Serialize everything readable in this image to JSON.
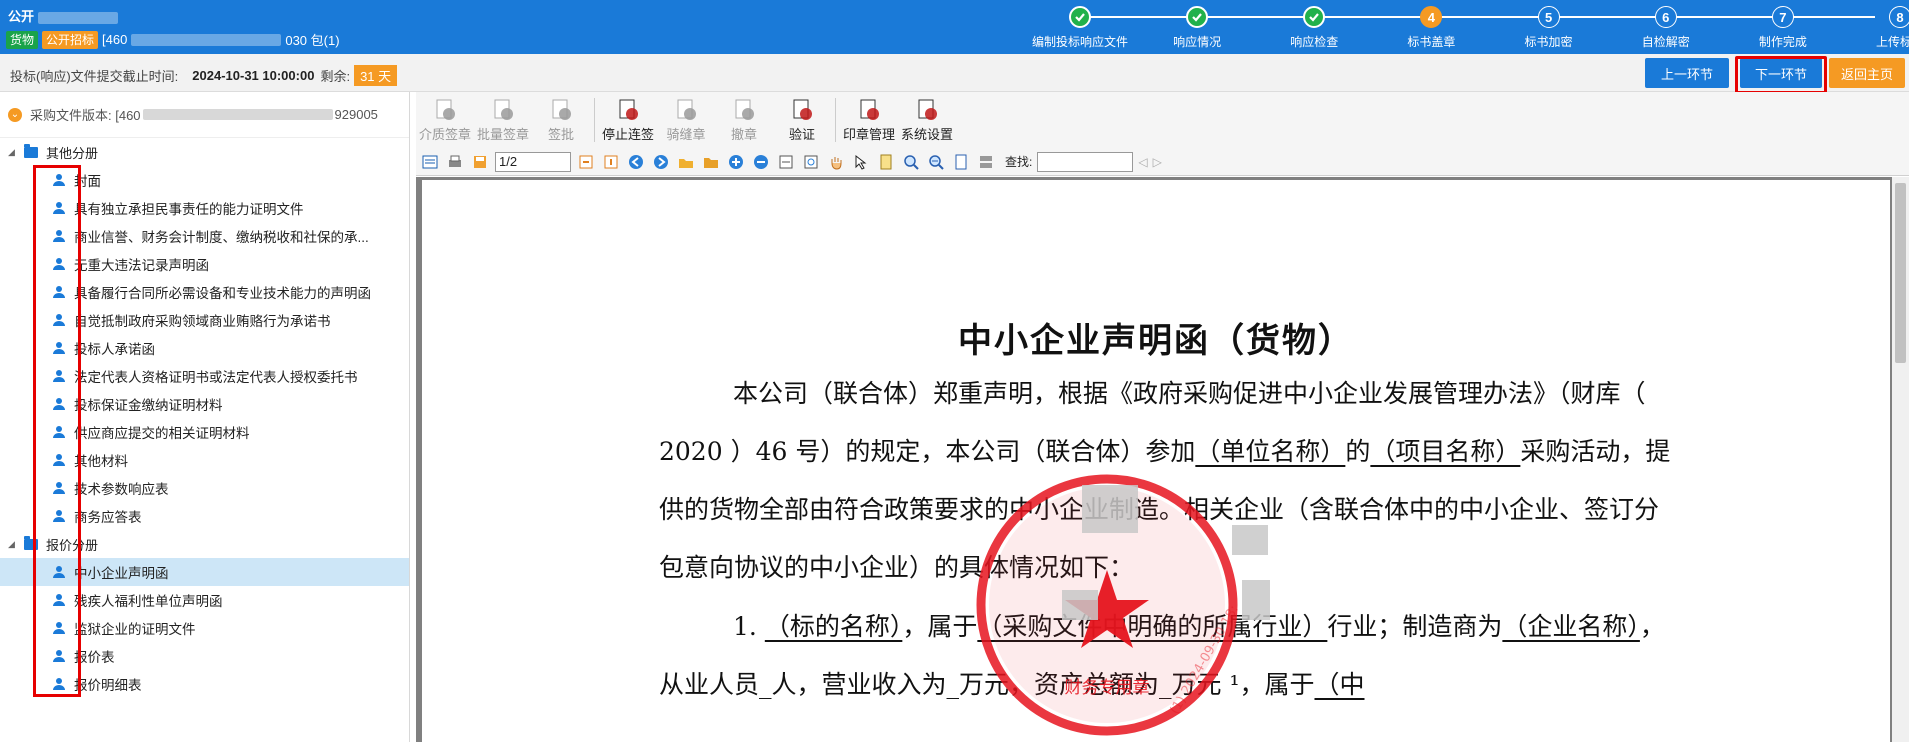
{
  "header": {
    "title_prefix": "公开",
    "tag_goods": "货物",
    "tag_open": "公开招标",
    "package_prefix": "[460",
    "package_suffix": "030  包(1)"
  },
  "steps": [
    {
      "label": "编制投标响应文件",
      "status": "done",
      "num": ""
    },
    {
      "label": "响应情况",
      "status": "done",
      "num": ""
    },
    {
      "label": "响应检查",
      "status": "done",
      "num": ""
    },
    {
      "label": "标书盖章",
      "status": "current",
      "num": "4"
    },
    {
      "label": "标书加密",
      "status": "todo",
      "num": "5"
    },
    {
      "label": "自检解密",
      "status": "todo",
      "num": "6"
    },
    {
      "label": "制作完成",
      "status": "todo",
      "num": "7"
    },
    {
      "label": "上传标书",
      "status": "todo",
      "num": "8"
    }
  ],
  "infobar": {
    "deadline_label": "投标(响应)文件提交截止时间:",
    "deadline_value": "2024-10-31 10:00:00",
    "remaining_label": "剩余:",
    "remaining_value": "31 天",
    "prev_button": "上一环节",
    "next_button": "下一环节",
    "home_button": "返回主页"
  },
  "sidebar": {
    "version_label": "采购文件版本: [460",
    "version_suffix": "929005",
    "groups": [
      {
        "label": "其他分册",
        "items": [
          "封面",
          "具有独立承担民事责任的能力证明文件",
          "商业信誉、财务会计制度、缴纳税收和社保的承...",
          "无重大违法记录声明函",
          "具备履行合同所必需设备和专业技术能力的声明函",
          "自觉抵制政府采购领域商业贿赂行为承诺书",
          "投标人承诺函",
          "法定代表人资格证明书或法定代表人授权委托书",
          "投标保证金缴纳证明材料",
          "供应商应提交的相关证明材料",
          "其他材料",
          "技术参数响应表",
          "商务应答表"
        ]
      },
      {
        "label": "报价分册",
        "items": [
          "中小企业声明函",
          "残疾人福利性单位声明函",
          "监狱企业的证明文件",
          "报价表",
          "报价明细表"
        ]
      }
    ],
    "selected": "中小企业声明函"
  },
  "toolbar": {
    "tools": [
      {
        "label": "介质签章",
        "icon": "media-sign-icon",
        "active": false
      },
      {
        "label": "批量签章",
        "icon": "batch-sign-icon",
        "active": false
      },
      {
        "label": "签批",
        "icon": "sign-approve-icon",
        "active": false
      },
      {
        "label": "停止连签",
        "icon": "stop-continuous-sign-icon",
        "active": true
      },
      {
        "label": "骑缝章",
        "icon": "seam-seal-icon",
        "active": false
      },
      {
        "label": "撤章",
        "icon": "revoke-seal-icon",
        "active": false
      },
      {
        "label": "验证",
        "icon": "verify-icon",
        "active": true
      },
      {
        "label": "印章管理",
        "icon": "seal-manage-icon",
        "active": true
      },
      {
        "label": "系统设置",
        "icon": "system-settings-icon",
        "active": true
      }
    ],
    "page_value": "1/2",
    "search_label": "查找:"
  },
  "document": {
    "title": "中小企业声明函（货物）",
    "p1_a": "本公司（联合体）郑重声明，根据《政府采购促进中小企业发展管理办法》（财库（ 2020 ）46  号）的规定，本公司（联合体）参加",
    "p1_u1": "（单位名称）",
    "p1_b": "的",
    "p1_u2": "（项目名称）",
    "p1_c": "采购活动，提供的货物全部由符合政策要求的中小企业制造。相关企业（含联合体中的中小企业、签订分包意向协议的中小企业）的具体情况如下：",
    "p2_a": "1. ",
    "p2_u1": "（标的名称）",
    "p2_b": "，属于",
    "p2_u2": "（采购文件中明确的所属行业）",
    "p2_c": "行业；制造商为",
    "p2_u3": "（企业名称）",
    "p2_d": "，从业人员_人，营业收入为_万元，资产总额为_万元 ¹，属于",
    "p2_u4": "（中",
    "seal_text": "财务专用章",
    "watermark": "(1)  2024-09-30 18:"
  },
  "colors": {
    "primary": "#1a7ad8",
    "accent": "#f59a23",
    "done": "#21b14b",
    "highlight": "#e60000"
  }
}
